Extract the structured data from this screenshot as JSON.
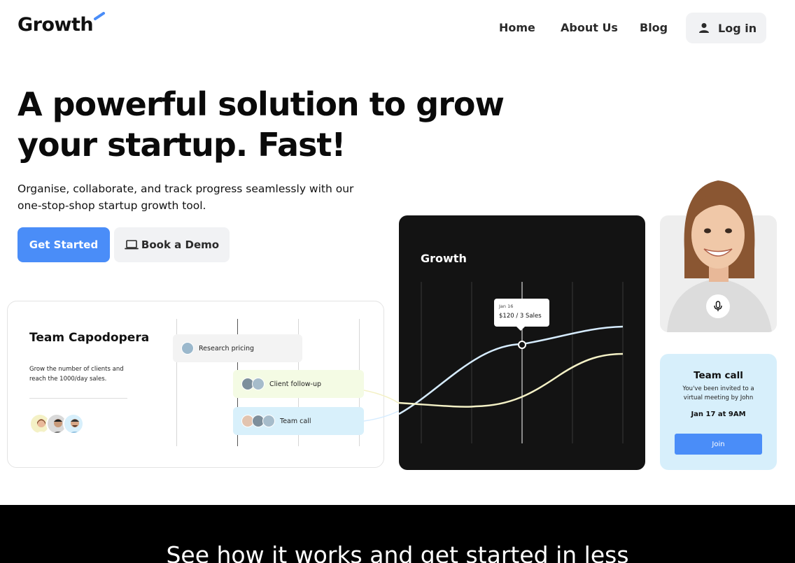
{
  "nav": {
    "logo": "Growth",
    "links": [
      "Home",
      "About Us",
      "Blog"
    ],
    "login_label": "Log in"
  },
  "hero": {
    "title_line1": "A powerful solution to grow",
    "title_line2": "your startup. Fast!",
    "subtitle_line1": "Organise, collaborate, and track progress seamlessly with our",
    "subtitle_line2": "one-stop-shop startup growth tool.",
    "primary_cta": "Get Started",
    "secondary_cta": "Book a Demo"
  },
  "team_card": {
    "title": "Team Capodopera",
    "description": "Grow the number of clients and reach the 1000/day sales.",
    "tasks": [
      {
        "label": "Research pricing",
        "color": "#f3f3f3"
      },
      {
        "label": "Client follow-up",
        "color": "#f4fbe4"
      },
      {
        "label": "Team call",
        "color": "#d8f0fb"
      }
    ]
  },
  "chart_card": {
    "title": "Growth",
    "tooltip_date": "Jan 16",
    "tooltip_value": "$120 / 3 Sales"
  },
  "call_card": {
    "title": "Team call",
    "description": "You've been invited to a virtual meeting by John",
    "date": "Jan 17 at 9AM",
    "join_label": "Join"
  },
  "band": {
    "text": "See how it works and get started in less"
  },
  "colors": {
    "accent": "#4a8df8",
    "dark_card": "#131313",
    "call_bg": "#d7effb",
    "line_blue": "#d6ecff",
    "line_yellow": "#f4f1c6"
  },
  "icons": {
    "logo_mark": "blue-slash-icon",
    "login": "user-icon",
    "demo": "laptop-icon",
    "mic": "microphone-icon"
  }
}
